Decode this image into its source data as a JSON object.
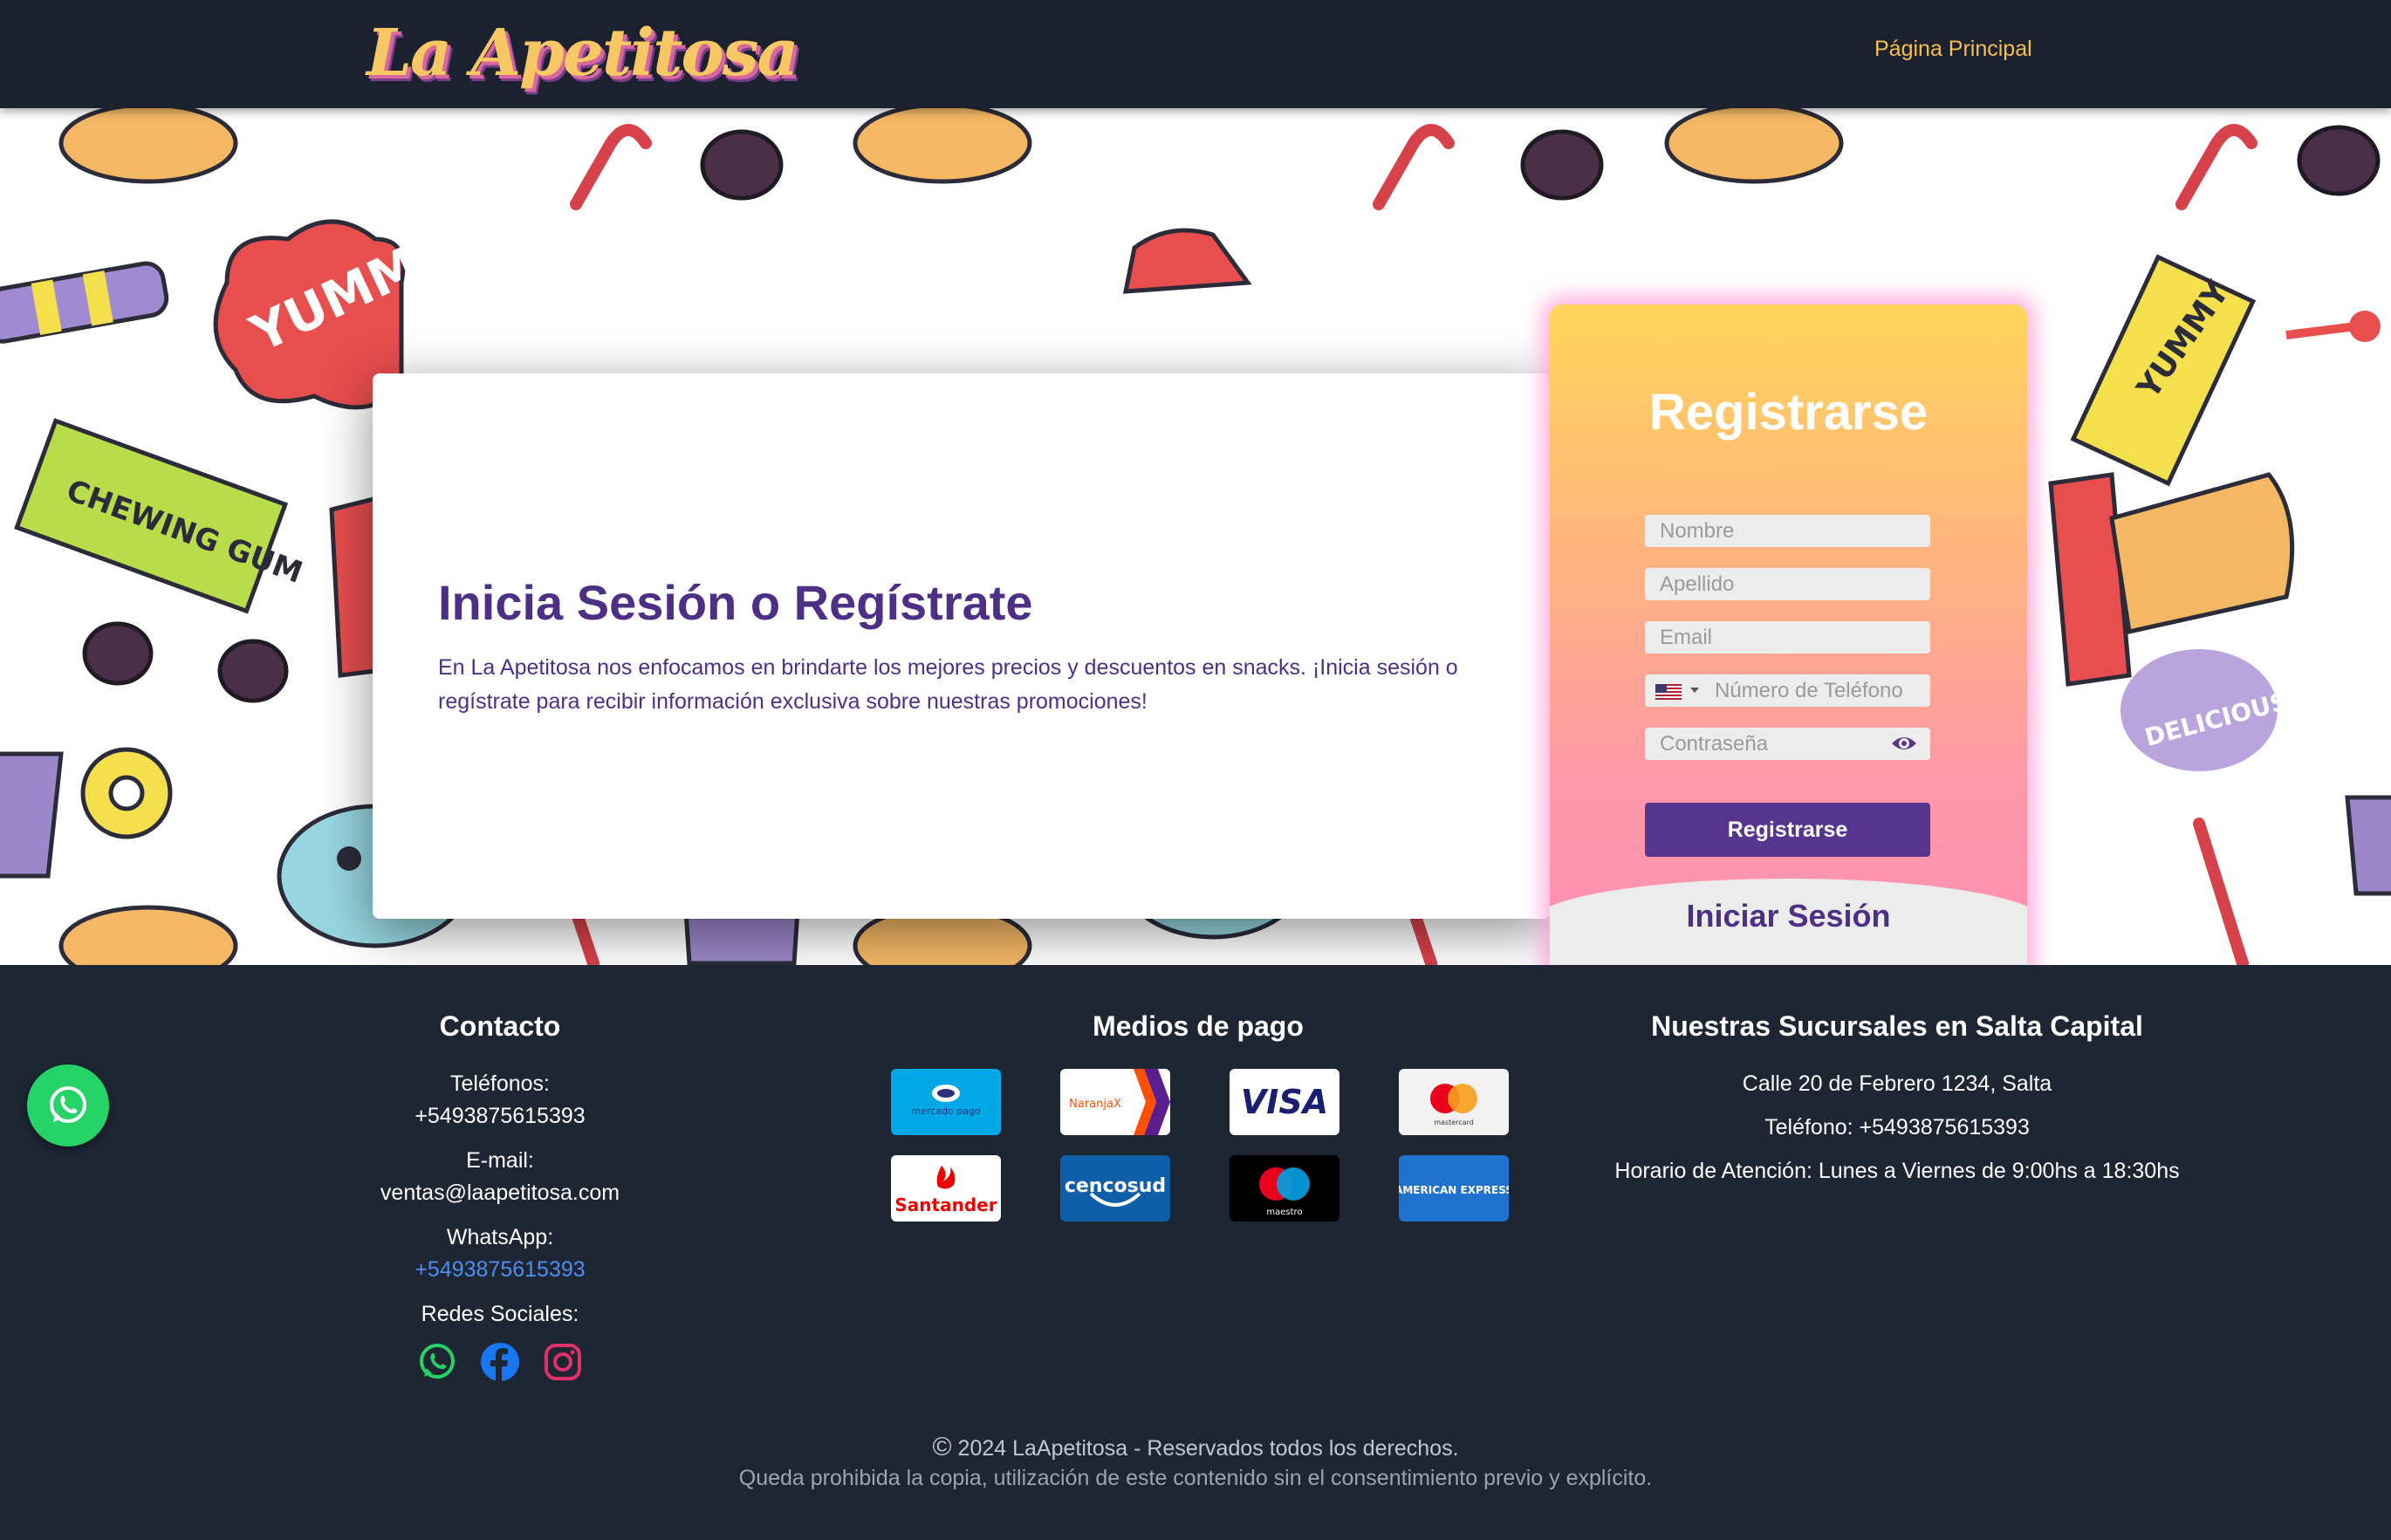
{
  "header": {
    "logo_text": "La Apetitosa",
    "nav_home": "Página Principal"
  },
  "hero": {
    "title": "Inicia Sesión o Regístrate",
    "description": "En La Apetitosa nos enfocamos en brindarte los mejores precios y descuentos en snacks. ¡Inicia sesión o regístrate para recibir información exclusiva sobre nuestras promociones!"
  },
  "register": {
    "title": "Registrarse",
    "nombre_placeholder": "Nombre",
    "apellido_placeholder": "Apellido",
    "email_placeholder": "Email",
    "phone_placeholder": "Número de Teléfono",
    "password_placeholder": "Contraseña",
    "submit_label": "Registrarse",
    "login_link": "Iniciar Sesión"
  },
  "footer": {
    "contact": {
      "title": "Contacto",
      "phones_label": "Teléfonos:",
      "phones_value": "+5493875615393",
      "email_label": "E-mail:",
      "email_value": "ventas@laapetitosa.com",
      "whatsapp_label": "WhatsApp:",
      "whatsapp_value": "+5493875615393",
      "social_label": "Redes Sociales:"
    },
    "payments": {
      "title": "Medios de pago",
      "methods": [
        "mercado pago",
        "NaranjaX",
        "VISA",
        "mastercard",
        "Santander",
        "cencosud",
        "maestro",
        "AMERICAN EXPRESS"
      ]
    },
    "branches": {
      "title": "Nuestras Sucursales en Salta Capital",
      "address": "Calle 20 de Febrero 1234, Salta",
      "phone": "Teléfono: +5493875615393",
      "hours": "Horario de Atención: Lunes a Viernes de 9:00hs a 18:30hs"
    },
    "copyright": "2024 LaApetitosa - Reservados todos los derechos.",
    "copyright_symbol": "©",
    "disclaimer": "Queda prohibida la copia, utilización de este contenido sin el consentimiento previo y explícito."
  },
  "colors": {
    "header_bg": "#1c2130",
    "nav_link": "#f5c04a",
    "accent_purple": "#57358f",
    "footer_bg": "#1e2533",
    "whatsapp_green": "#25d366"
  },
  "icons": [
    "whatsapp-icon",
    "facebook-icon",
    "instagram-icon",
    "eye-icon",
    "us-flag-icon",
    "copyright-icon"
  ]
}
